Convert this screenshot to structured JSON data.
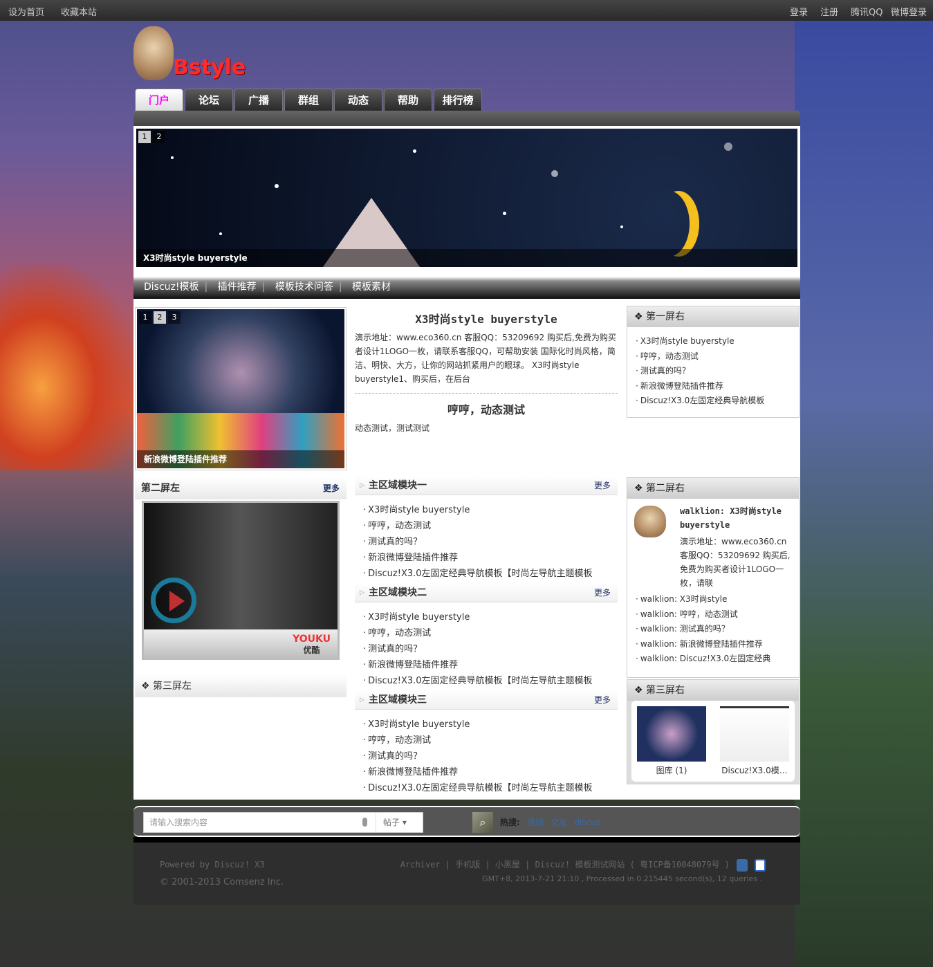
{
  "topbar": {
    "left": [
      "设为首页",
      "收藏本站"
    ],
    "right": [
      "登录",
      "注册",
      "腾讯QQ",
      "微博登录"
    ]
  },
  "logo": {
    "text": "Bstyle"
  },
  "nav": [
    "门户",
    "论坛",
    "广播",
    "群组",
    "动态",
    "帮助",
    "排行榜"
  ],
  "banner": {
    "pages": [
      "1",
      "2"
    ],
    "caption": "X3时尚style buyerstyle"
  },
  "subnav": [
    "Discuz!模板",
    "插件推荐",
    "模板技术问答",
    "模板素材"
  ],
  "slide2": {
    "pages": [
      "1",
      "2",
      "3"
    ],
    "caption": "新浪微博登陆插件推荐"
  },
  "articles": [
    {
      "title": "X3时尚style buyerstyle",
      "body": "演示地址：www.eco360.cn 客服QQ：53209692 购买后,免费为购买者设计1LOGO一枚，请联系客服QQ，可帮助安装 国际化时尚风格，简洁、明快、大方，让你的网站抓紧用户的眼球。 X3时尚style buyerstyle1、购买后，在后台"
    },
    {
      "title": "哼哼，动态测试",
      "body": "动态测试，测试测试"
    }
  ],
  "first_right": {
    "title": "第一屏右",
    "items": [
      "X3时尚style buyerstyle",
      "哼哼，动态测试",
      "测试真的吗？",
      "新浪微博登陆插件推荐",
      "Discuz!X3.0左固定经典导航模板"
    ]
  },
  "second_left": {
    "title": "第二屏左",
    "more": "更多",
    "video": {
      "brand": "优酷",
      "logo": "YOUKU"
    }
  },
  "third_left": {
    "title": "第三屏左"
  },
  "modules": [
    {
      "title": "主区域模块一",
      "more": "更多",
      "items": [
        "X3时尚style buyerstyle",
        "哼哼，动态测试",
        "测试真的吗？",
        "新浪微博登陆插件推荐",
        "Discuz!X3.0左固定经典导航模板【时尚左导航主题模板"
      ]
    },
    {
      "title": "主区域模块二",
      "more": "更多",
      "items": [
        "X3时尚style buyerstyle",
        "哼哼，动态测试",
        "测试真的吗？",
        "新浪微博登陆插件推荐",
        "Discuz!X3.0左固定经典导航模板【时尚左导航主题模板"
      ]
    },
    {
      "title": "主区域模块三",
      "more": "更多",
      "items": [
        "X3时尚style buyerstyle",
        "哼哼，动态测试",
        "测试真的吗？",
        "新浪微博登陆插件推荐",
        "Discuz!X3.0左固定经典导航模板【时尚左导航主题模板"
      ]
    }
  ],
  "second_right": {
    "title": "第二屏右",
    "feature_title": "walklion: X3时尚style buyerstyle",
    "feature_body": "演示地址：www.eco360.cn 客服QQ：53209692 购买后,免费为购买者设计1LOGO一枚，请联",
    "items": [
      "walklion: X3时尚style",
      "walklion: 哼哼，动态测试",
      "walklion: 测试真的吗？",
      "walklion: 新浪微博登陆插件推荐",
      "walklion: Discuz!X3.0左固定经典"
    ]
  },
  "third_right": {
    "title": "第三屏右",
    "thumbs": [
      "图库 (1)",
      "Discuz!X3.0模…"
    ]
  },
  "search": {
    "placeholder": "请输入搜索内容",
    "type": "帖子",
    "hot_label": "热搜:",
    "hot": [
      "活动",
      "交友",
      "discuz"
    ]
  },
  "footer": {
    "powered": "Powered by Discuz! X3",
    "copyright": "© 2001-2013 Comsenz Inc.",
    "links": "Archiver | 手机版 | 小黑屋 | Discuz! 模板测试网站 ( 粤ICP备10048079号 )",
    "stats": "GMT+8, 2013-7-21 21:10 , Processed in 0.215445 second(s), 12 queries ."
  },
  "colors": {
    "accent": "#ff00ff",
    "logo": "#ff2a2a",
    "link": "#3a6aa8"
  }
}
